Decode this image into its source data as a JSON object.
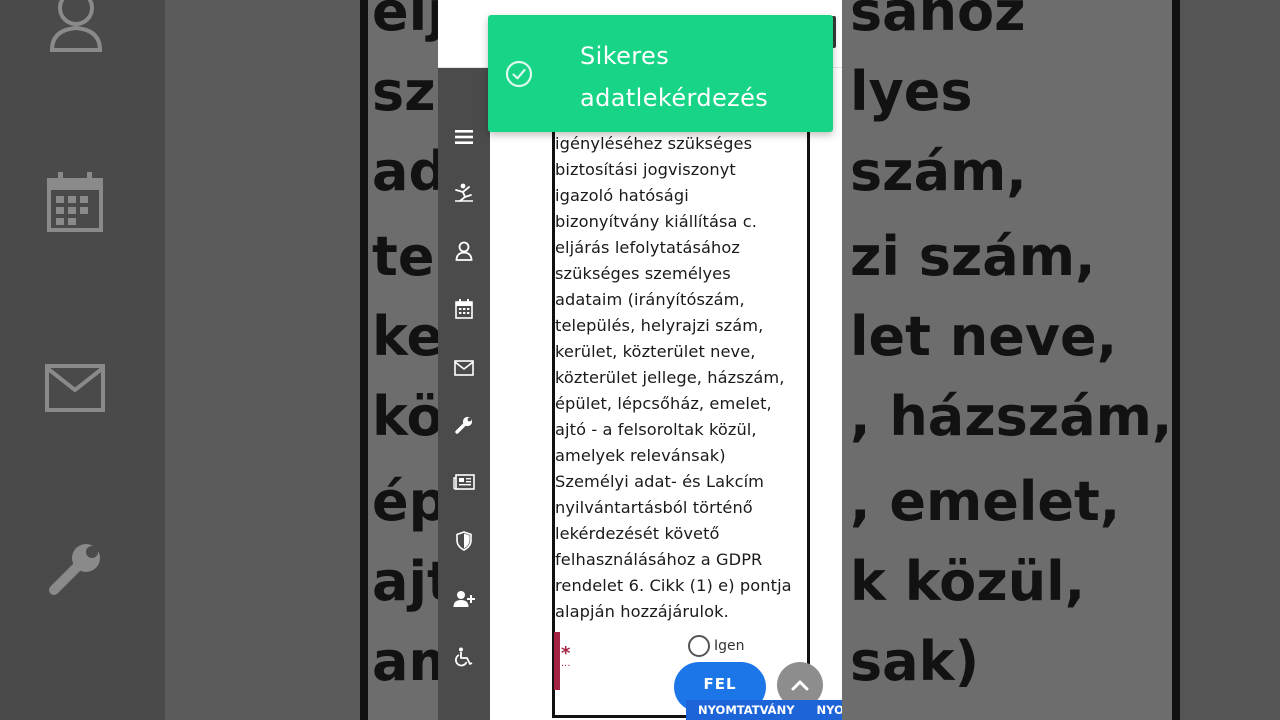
{
  "background": {
    "text_lines": [
      "eljárás lefolytatásához",
      "szükséges személyes",
      "adataim (irányítószám,",
      "település, helyrajzi szám,",
      "kerület, közterület neve,",
      "közterület jellege, házszám,",
      "épület, lépcsőház, emelet,",
      "ajtó - a felsoroltak közül,",
      "amelyek relevánsak)"
    ],
    "visible_fragments": [
      "eljárás lefolytatásához",
      "szükséges személyes",
      "adataim (irányítószám,",
      "település, helyrajzi szám,",
      "kerület, közterület neve,",
      "közterület jellege, házszám,",
      "épület, lépcsőház, emelet,",
      "ajtó - a felsoroltak közül,",
      "amelyek relevánsak)"
    ]
  },
  "toast": {
    "message_line1": "Sikeres",
    "message_line2": "adatlekérdezés",
    "icon": "check-circle-icon",
    "color": "#17d486"
  },
  "sidebar": {
    "items": [
      {
        "icon": "menu-icon"
      },
      {
        "icon": "accessibility-figure-icon"
      },
      {
        "icon": "user-icon"
      },
      {
        "icon": "calendar-icon"
      },
      {
        "icon": "mail-icon"
      },
      {
        "icon": "wrench-icon"
      },
      {
        "icon": "newspaper-icon"
      },
      {
        "icon": "shield-icon"
      },
      {
        "icon": "add-user-icon"
      },
      {
        "icon": "wheelchair-icon"
      }
    ]
  },
  "consent": {
    "lines": [
      "igényléséhez szükséges",
      "biztosítási jogviszonyt",
      "igazoló hatósági",
      "bizonyítvány kiállítása c.",
      "eljárás lefolytatásához",
      "szükséges személyes",
      "adataim (irányítószám,",
      "település, helyrajzi szám,",
      "kerület, közterület neve,",
      "közterület jellege, házszám,",
      "épület, lépcsőház, emelet,",
      "ajtó - a felsoroltak közül,",
      "amelyek relevánsak)",
      "Személyi adat- és Lakcím",
      "nyilvántartásból történő",
      "lekérdezését követő",
      "felhasználásához a GDPR",
      "rendelet 6. Cikk (1) e) pontja",
      "alapján hozzájárulok."
    ]
  },
  "form": {
    "required_marker": "*",
    "radio_label": "Igen",
    "upload_button": "FEL",
    "print_items": [
      "NYOMTATVÁNY",
      "NYOM"
    ],
    "accent_color": "#1d76e8",
    "required_color": "#a32342"
  }
}
